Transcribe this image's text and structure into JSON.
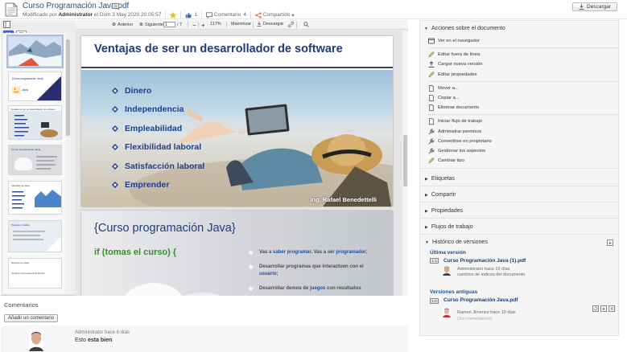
{
  "header": {
    "title": "Curso Programación Java.pdf",
    "modified_prefix": "Modificado por",
    "modified_user": "Administrator",
    "modified_date": "el Dom 3 May 2020 20:05:57",
    "likes": "1",
    "comment_label": "Comentario",
    "comment_count": "4",
    "shared_label": "Compartido",
    "download_label": "Descargar"
  },
  "toolbar": {
    "prev": "Anterior",
    "next": "Siguiente",
    "page_value": "1",
    "page_total": "/ 7",
    "zoom": "117%",
    "maximize": "Maximizar",
    "download": "Descargar"
  },
  "slide1": {
    "title": "Ventajas de ser un desarrollador de software",
    "items": [
      "Dinero",
      "Independencia",
      "Empleabilidad",
      "Flexibilidad laboral",
      "Satisfacción laboral",
      "Emprender"
    ],
    "signature": "Ing. Rafael Benedettelli"
  },
  "slide2": {
    "title": "{Curso programación Java}",
    "subtitle": "if (tomas el curso) {",
    "b1_a": "Vas a ",
    "b1_b": "saber programar",
    "b1_c": ". Vas a ser ",
    "b1_d": "programador",
    "b1_e": ";",
    "b2": "Desarrollar programas que interactuen con el",
    "b2_b": "usuario",
    "b2_c": ";",
    "b3_a": "Desarrollar demos de ",
    "b3_b": "juegos",
    "b3_c": " con resultados"
  },
  "thumbnails": {
    "t2_title": "{Curso programación Java}",
    "t3_title": "Ventajas de ser un desarrollador de software",
    "t4_title": "{Curso programación Java}",
    "t5_title": "Ventajas de Java",
    "t6_title": "{Sintaxis y Estilo}",
    "t7_title": "Sintaxis en Java",
    "t7_text": "Syntaxis una prueba Hola Mundo"
  },
  "comments": {
    "label": "Comentarios",
    "add_button": "Añadir un comentario",
    "entry": {
      "meta": "Administrator hace 6 días",
      "text_a": "Esto ",
      "text_b": "esta bien"
    }
  },
  "panel": {
    "actions_title": "Acciones sobre el documento",
    "actions": [
      "Ver en el navegador",
      "Editar fuera de línea",
      "Cargar nueva versión",
      "Editar propiedades",
      "Mover a...",
      "Copiar a...",
      "Eliminar documento",
      "Iniciar flujo de trabajo",
      "Administrar permisos",
      "Convertirse en propietario",
      "Gestionar los aspectos",
      "Cambiar tipo"
    ],
    "sections": [
      "Etiquetas",
      "Compartir",
      "Propiedades",
      "Flujos de trabajo",
      "Histórico de versiones"
    ],
    "latest_label": "Última versión",
    "latest": {
      "version": "1.1",
      "name": "Curso Programación Java (1).pdf",
      "author_line": "Administrator hace 10 días",
      "comment": "cambios de indices del documento"
    },
    "old_label": "Versiones antiguas",
    "old": {
      "version": "1.0",
      "name": "Curso Programación Java.pdf",
      "author_line": "Ramon Jimenez hace 10 días",
      "comment": "(Sin comentarios)"
    }
  },
  "colors": {
    "brand_blue": "#1f3d78",
    "link_blue": "#2c4d7a",
    "green": "#3a8f2b",
    "panel_bg": "#f5f5f5"
  }
}
